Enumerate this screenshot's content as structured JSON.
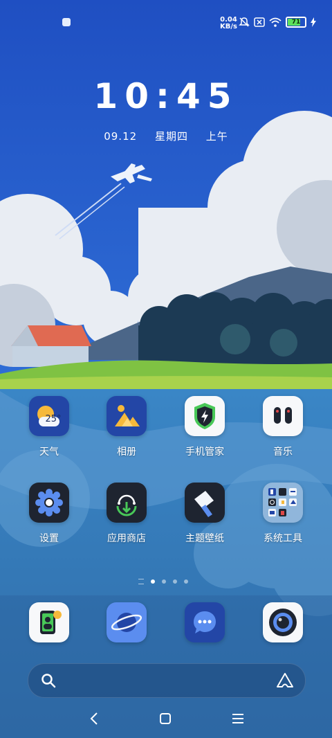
{
  "status_bar": {
    "speed_value": "0.04",
    "speed_unit": "KB/s",
    "battery_level": "71",
    "battery_fraction": 0.71,
    "icons": [
      "notification-icon",
      "bell-mute-icon",
      "no-sim-icon",
      "wifi-icon",
      "battery-icon",
      "charging-icon"
    ]
  },
  "lock": {
    "time": "10:45",
    "date": "09.12",
    "weekday": "星期四",
    "period": "上午"
  },
  "apps": [
    {
      "label": "天气",
      "icon": "weather-icon",
      "badge": "25°"
    },
    {
      "label": "相册",
      "icon": "gallery-icon"
    },
    {
      "label": "手机管家",
      "icon": "phone-manager-icon"
    },
    {
      "label": "音乐",
      "icon": "music-icon"
    },
    {
      "label": "设置",
      "icon": "settings-icon"
    },
    {
      "label": "应用商店",
      "icon": "app-store-icon"
    },
    {
      "label": "主题壁纸",
      "icon": "theme-icon"
    },
    {
      "label": "系统工具",
      "icon": "system-tools-folder-icon"
    }
  ],
  "dock": [
    {
      "icon": "phone-icon"
    },
    {
      "icon": "browser-icon"
    },
    {
      "icon": "messages-icon"
    },
    {
      "icon": "camera-icon"
    }
  ],
  "pager": {
    "page_count": 4,
    "current_page": 1
  },
  "colors": {
    "sky": "#2458c8",
    "water": "#3a7cc0",
    "grass": "#7fc243",
    "roof": "#e06a52"
  }
}
